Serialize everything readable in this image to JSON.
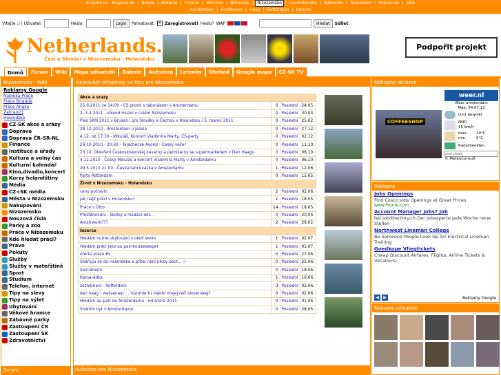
{
  "top_links": [
    "Krajane.cz - Krajania.sk",
    "Belgie",
    "Británie",
    "Francie",
    "Mnichov",
    "Německo",
    "Nizozemsko",
    "Lucembursko",
    "Rakousko",
    "Španělsko",
    "Švýcarsko",
    "USA"
  ],
  "top_links2": [
    "Amsterdam",
    "Eindhoven",
    "Haag",
    "Rotterdam",
    "Utrecht"
  ],
  "login": {
    "greeting": "Vítejte :) | Uživatel:",
    "password": "Heslo:",
    "login_btn": "Login",
    "remember": "Pamatovat:",
    "register": "Zaregistrovat!",
    "forgot": "Heslo?",
    "wap": "WAP",
    "search_btn": "Hledat",
    "share": "Sdílet"
  },
  "logo": {
    "title": "Netherlands.cz",
    "subtitle": "Češi a Slováci v Nizozemsku - Holandsku"
  },
  "support_button": "Podpořit projekt",
  "nav": [
    "Domů",
    "Forum",
    "Wiki",
    "Mapa uživatelů",
    "Galerie",
    "Autostop",
    "Letenky",
    "Obchod",
    "Google mapa",
    "CZ-SK TV"
  ],
  "left": {
    "title": "Nizozemsko - Wiki",
    "heading": "Reklamy Google",
    "sublinks": [
      "Nabídka Práce",
      "Práce Brigáda",
      "Práce Anglie",
      "Zahraničí",
      "Holandsko"
    ],
    "items": [
      "CZ-SK akce a srazy",
      "Doprava",
      "Doprava ČR-SR-NL",
      "Finance",
      "Instituce a úřady",
      "Kultura a volný čas",
      "Kulturní kalendář",
      "Kino,divadlo,koncert",
      "Kurzy holandštiny",
      "Média",
      "CZ+SK média",
      "Města v Nizozemsku",
      "Nakupování",
      "Nizozemsko",
      "Nouzová čísla",
      "Parky a zoo",
      "Práce v Nizozemsku",
      "Kde hledat práci?",
      "Právo",
      "Pokuty",
      "Služby",
      "Služby v mateřštině",
      "Sport",
      "Studium",
      "Telefon, internet",
      "Tipy na slevy",
      "Tipy na výlet",
      "Ubytování",
      "Věkové hranice",
      "Zábavné parky",
      "Zastoupení ČR",
      "Zastoupení SK",
      "Zdravotnictví"
    ],
    "bottom": "Servis"
  },
  "mid": {
    "title": "Nejnovější příspěvky ve fóru pro Nizozemsko",
    "last": "Poslední",
    "sections": [
      {
        "name": "Akce a srazy",
        "rows": [
          [
            "25.6.2011 ve 14:00 - CS piknik s táborákem v Amsterdamu",
            "0",
            "24.05."
          ],
          [
            "2.-3.4.2011 - víkend muzeí v celém Nizozemsku",
            "0",
            "30.03."
          ],
          [
            "Ples SKM 2011 v Bruseli i pro Slováky a Čechov v Holandsku / 5. marec 2011",
            "0",
            "25.02."
          ],
          [
            "28.12.2010 - Amsterdam u jesela",
            "0",
            "27.12."
          ],
          [
            "4.12. od 17:30 - Mikuláš, Koncert Vladimira Marty, CS-party",
            "0",
            "02.12."
          ],
          [
            "29.10.2010 - 20:30 - Tajechecke Avond - Český večer",
            "0",
            "11.10."
          ],
          [
            "23.10. Otevření Československej kavarny a pemikarny se supermarketem v Den Haagu",
            "0",
            "06.10."
          ],
          [
            "4.12.2010 - Český Mikuláš a koncert Vladimira Marty v Amsterdamu",
            "0",
            "06.10."
          ],
          [
            "29.5.2010 21:00 - Česká tancovačka v Amsterdamu",
            "1",
            "12.06."
          ],
          [
            "Party Rotterdam",
            "0",
            "15.05."
          ]
        ]
      },
      {
        "name": "Život v Nizozemsku - Holandsku",
        "rows": [
          [
            "ceny potravin",
            "2",
            "02.06."
          ],
          [
            "jak najít práci v Holandsku?",
            "1",
            "18.05."
          ],
          [
            "Práce v Otto",
            "14",
            "18.05."
          ],
          [
            "Přestěhování - Skolky a hledání dět...",
            "0",
            "20.04."
          ],
          [
            "Amstrwork???",
            "2",
            "26.02."
          ]
        ]
      },
      {
        "name": "Inzerce",
        "rows": [
          [
            "Hledám nutné ubytování v okolí Venlo",
            "1",
            "02.07."
          ],
          [
            "Hledám práci jako au pair/housekeeper",
            "1",
            "01.07."
          ],
          [
            "oferta práce HL",
            "0",
            "27.06."
          ],
          [
            "Sháňuju se do Holandska a přítel není nikdy doct... :)",
            "0",
            "25.06."
          ],
          [
            "Seznámení",
            "0",
            "18.06."
          ],
          [
            "Kamarádka",
            "1",
            "16.06."
          ],
          [
            "seznámení - Rotterdam",
            "3",
            "02.06."
          ],
          [
            "den haag - wassenaar ... rozumie tu niekto mojej reči slovenskej?",
            "0",
            "02.06."
          ],
          [
            "Hledám au-pair do Amsterdamu - od srpna 2011",
            "0",
            "01.06."
          ],
          [
            "Sháním byt v Amsterdamu",
            "0",
            "28.05."
          ]
        ]
      }
    ]
  },
  "autostop_title": "Autostop pro Nizozemsko",
  "right": {
    "random_title": "Náhodný obrázek",
    "coffeeshop": "COFFEESHOP",
    "weather": {
      "logo": "weer.nl",
      "city": "Weer amsterdam",
      "date": "Maa, 04.07.11",
      "desc": "licht bewolkt",
      "wind_dir": "NNO",
      "wind": "15 km/h",
      "max_label": "max.",
      "max": "20°C",
      "min_label": "min.",
      "min": "9°C",
      "link": "Radarbeelden",
      "search_placeholder": "zoek plaats",
      "credit": "© MeteoConsult"
    },
    "reklama_title": "Reklama",
    "ads": [
      {
        "h": "Jobs Openings",
        "b": "Find Cosco Jobs Openings at Great Prices.",
        "u": "www.Pronto.com"
      },
      {
        "h": "Account Manager Jobs? Job",
        "b": "bei Jobdirectory.ch:Der Jobexperte Jede Woche neue Stellen",
        "u": ""
      },
      {
        "h": "Northwest Lineman College",
        "b": "Be Someone People Look Up To! Electrical Lineman Training",
        "u": ""
      },
      {
        "h": "Goedkope Vliegtickets",
        "b": "Cheap Discount Airfares, Flights, Airline Tickets & Vacations.",
        "u": ""
      }
    ],
    "adfooter": "Reklamy Google",
    "users_title": "Náhodní uživatelé"
  },
  "colors": {
    "accent": "#ff8c00",
    "link": "#1a1aa6"
  }
}
